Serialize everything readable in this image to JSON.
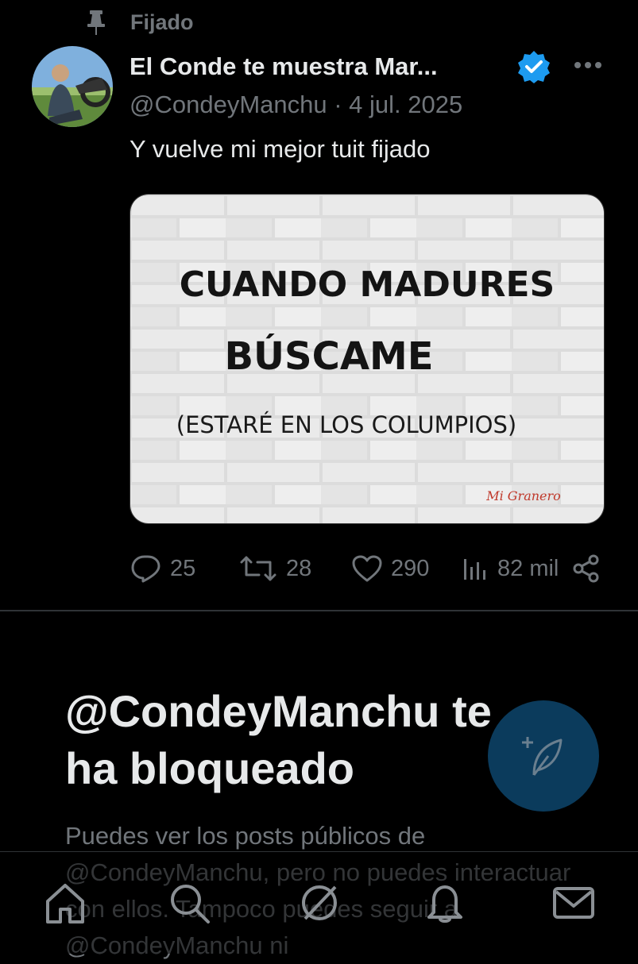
{
  "pinned": {
    "label": "Fijado",
    "icon": "pin-icon"
  },
  "tweet": {
    "author_name": "El Conde te muestra Mar...",
    "handle_date": "@CondeyManchu · 4 jul. 2025",
    "text": "Y vuelve mi mejor tuit fijado",
    "verified_icon": "verified-badge-icon",
    "more_icon": "more-options-icon",
    "media": {
      "line1": "CUANDO MADURES",
      "line2": "BÚSCAME",
      "line3": "(ESTARÉ EN LOS COLUMPIOS)",
      "signature": "Mi Granero"
    },
    "actions": {
      "replies": "25",
      "reposts": "28",
      "likes": "290",
      "views": "82 mil"
    }
  },
  "blocked": {
    "title": "@CondeyManchu te ha bloqueado",
    "body": "Puedes ver los posts públicos de @CondeyManchu, pero no puedes interactuar con ellos. Tampoco puedes seguir a @CondeyManchu ni"
  },
  "nav": [
    "home-icon",
    "search-icon",
    "grok-icon",
    "notifications-icon",
    "messages-icon"
  ],
  "colors": {
    "background": "#000000",
    "text": "#e7e9ea",
    "muted": "#71767b",
    "accent": "#1d9bf0",
    "fab": "#0b3b5c"
  }
}
